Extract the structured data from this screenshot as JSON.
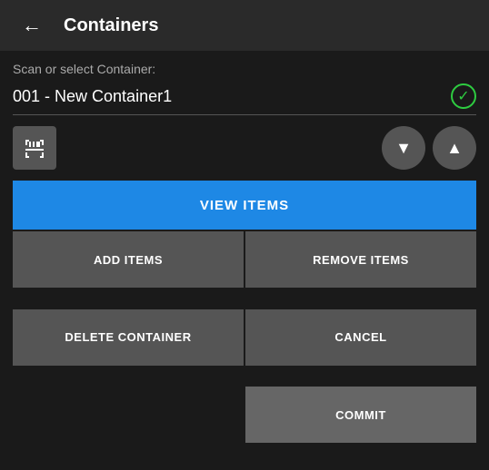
{
  "header": {
    "back_label": "←",
    "title": "Containers"
  },
  "main": {
    "scan_label": "Scan or select Container:",
    "container_value": "001 - New Container1",
    "check_symbol": "✓",
    "scanner_icon": "⬆",
    "arrow_down_icon": "▼",
    "arrow_up_icon": "▲"
  },
  "buttons": {
    "view_items": "VIEW ITEMS",
    "add_items": "ADD ITEMS",
    "remove_items": "REMOVE ITEMS",
    "delete_container": "DELETE CONTAINER",
    "cancel": "CANCEL",
    "commit": "COMMIT"
  }
}
